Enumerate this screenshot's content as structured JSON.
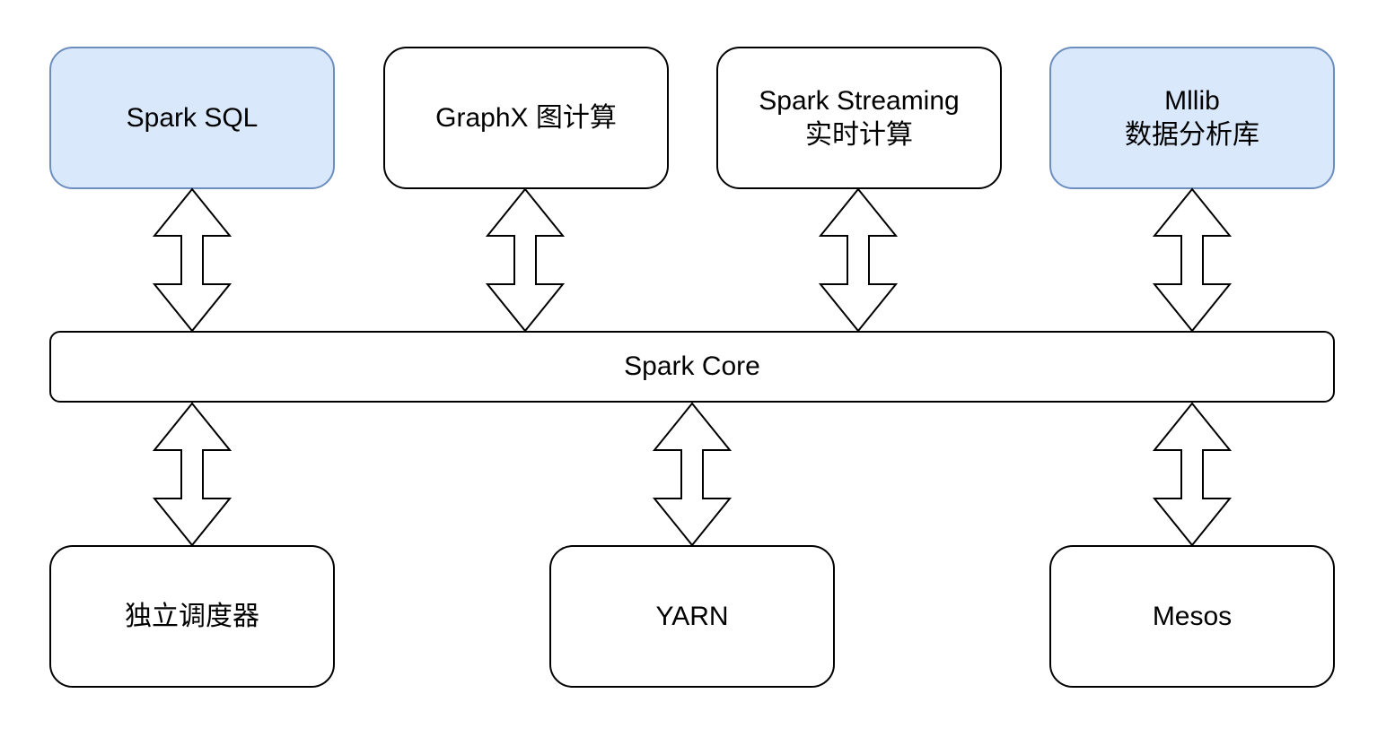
{
  "diagram": {
    "top_layer": [
      {
        "id": "spark-sql",
        "lines": [
          "Spark SQL"
        ],
        "highlight": true
      },
      {
        "id": "graphx",
        "lines": [
          "GraphX 图计算"
        ],
        "highlight": false
      },
      {
        "id": "spark-streaming",
        "lines": [
          "Spark Streaming",
          "实时计算"
        ],
        "highlight": false
      },
      {
        "id": "mllib",
        "lines": [
          "Mllib",
          "数据分析库"
        ],
        "highlight": true
      }
    ],
    "core": {
      "label": "Spark Core"
    },
    "bottom_layer": [
      {
        "id": "standalone",
        "lines": [
          "独立调度器"
        ]
      },
      {
        "id": "yarn",
        "lines": [
          "YARN"
        ]
      },
      {
        "id": "mesos",
        "lines": [
          "Mesos"
        ]
      }
    ],
    "colors": {
      "highlight_fill": "#dae8fc",
      "highlight_stroke": "#6c8ebf",
      "default_fill": "#ffffff",
      "stroke": "#000000"
    },
    "connectors": "bidirectional-arrows"
  }
}
